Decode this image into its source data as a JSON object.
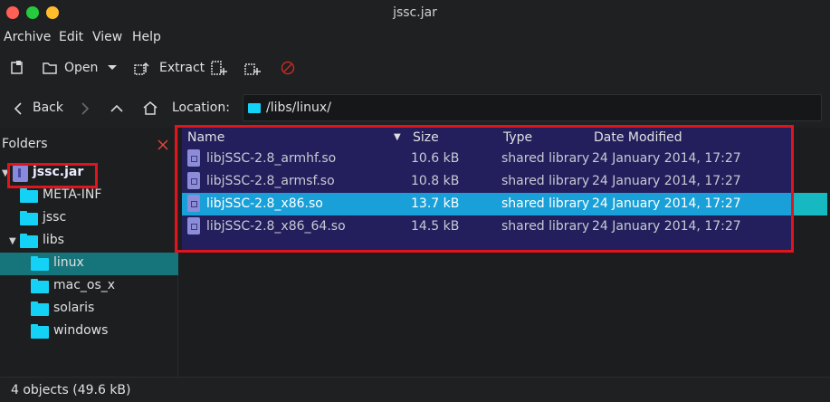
{
  "window": {
    "title": "jssc.jar"
  },
  "menu": [
    "Archive",
    "Edit",
    "View",
    "Help"
  ],
  "toolbar": {
    "open_label": "Open",
    "extract_label": "Extract"
  },
  "nav": {
    "back_label": "Back",
    "location_label": "Location:",
    "location_value": "/libs/linux/"
  },
  "sidebar": {
    "title": "Folders",
    "tree": [
      {
        "label": "jssc.jar"
      },
      {
        "label": "META-INF"
      },
      {
        "label": "jssc"
      },
      {
        "label": "libs"
      },
      {
        "label": "linux"
      },
      {
        "label": "mac_os_x"
      },
      {
        "label": "solaris"
      },
      {
        "label": "windows"
      }
    ]
  },
  "table": {
    "columns": [
      "Name",
      "Size",
      "Type",
      "Date Modified"
    ],
    "rows": [
      {
        "name": "libjSSC-2.8_armhf.so",
        "size": "10.6 kB",
        "type": "shared library",
        "date": "24 January 2014, 17:27"
      },
      {
        "name": "libjSSC-2.8_armsf.so",
        "size": "10.8 kB",
        "type": "shared library",
        "date": "24 January 2014, 17:27"
      },
      {
        "name": "libjSSC-2.8_x86.so",
        "size": "13.7 kB",
        "type": "shared library",
        "date": "24 January 2014, 17:27"
      },
      {
        "name": "libjSSC-2.8_x86_64.so",
        "size": "14.5 kB",
        "type": "shared library",
        "date": "24 January 2014, 17:27"
      }
    ]
  },
  "status": {
    "text": "4 objects (49.6 kB)"
  },
  "colors": {
    "selection": "#1aa0d8",
    "folder": "#14d2f5",
    "highlight_box": "#e0141d",
    "row_bg": "#221f5c"
  }
}
